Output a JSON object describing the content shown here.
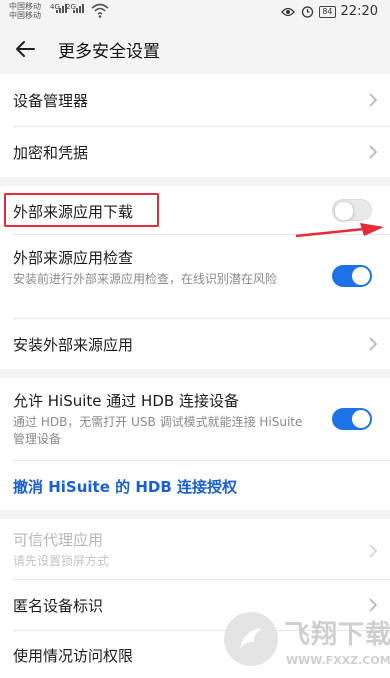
{
  "status_bar": {
    "carrier_1": "中国移动",
    "carrier_2": "中国移动",
    "signal_1_type": "4G",
    "signal_2_type": "2G",
    "battery": "84",
    "time": "22:20",
    "icons": [
      "eye-icon",
      "alarm-icon",
      "battery-icon"
    ]
  },
  "header": {
    "back_icon": "arrow-left-icon",
    "title": "更多安全设置"
  },
  "groups": {
    "device": {
      "device_manager": "设备管理器",
      "encryption": "加密和凭据"
    },
    "sources": {
      "external_download": {
        "label": "外部来源应用下载",
        "enabled": false
      },
      "external_check": {
        "label": "外部来源应用检查",
        "subtitle": "安装前进行外部来源应用检查，在线识别潜在风险",
        "enabled": true
      },
      "install_external": "安装外部来源应用"
    },
    "hisuite": {
      "allow_hdb": {
        "label": "允许 HiSuite 通过 HDB 连接设备",
        "subtitle": "通过 HDB，无需打开 USB 调试模式就能连接 HiSuite 管理设备",
        "enabled": true
      },
      "revoke_link": "撤消 HiSuite 的 HDB 连接授权"
    },
    "other": {
      "trust_agent": {
        "label": "可信代理应用",
        "subtitle": "请先设置锁屏方式"
      },
      "anonymous_id": "匿名设备标识",
      "usage_access": "使用情况访问权限"
    }
  },
  "watermark": {
    "brand": "飞翔下载",
    "url": "WWW.FXXZ.COM"
  },
  "colors": {
    "accent": "#1d73e6",
    "link": "#1a5fd1",
    "highlight": "#e32b3a"
  }
}
